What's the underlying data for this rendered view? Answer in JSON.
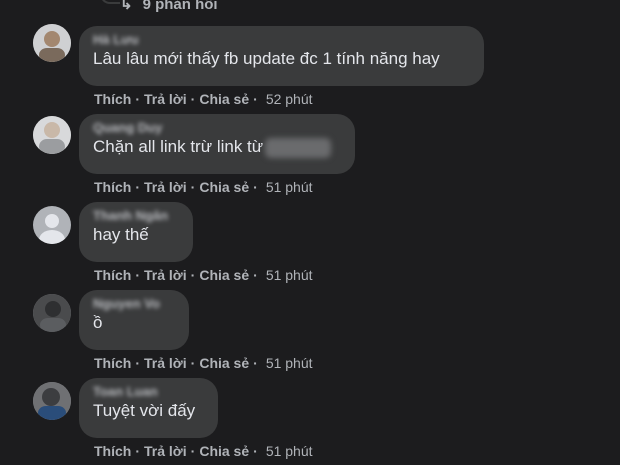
{
  "top": {
    "replies_label": "9 phản hồi"
  },
  "actions": {
    "like": "Thích",
    "reply": "Trả lời",
    "share": "Chia sẻ",
    "sep": "·"
  },
  "comments": [
    {
      "author": "Hà Lưu",
      "text": "Lâu lâu mới thấy fb update đc 1 tính năng hay",
      "time": "52 phút"
    },
    {
      "author": "Quang Duy",
      "text": "Chặn all link trừ link từ",
      "time": "51 phút"
    },
    {
      "author": "Thanh Ngân",
      "text": "hay thế",
      "time": "51 phút"
    },
    {
      "author": "Nguyen Vo",
      "text": "ồ",
      "time": "51 phút"
    },
    {
      "author": "Toan Luan",
      "text": "Tuyệt vời đấy",
      "time": "51 phút"
    }
  ]
}
